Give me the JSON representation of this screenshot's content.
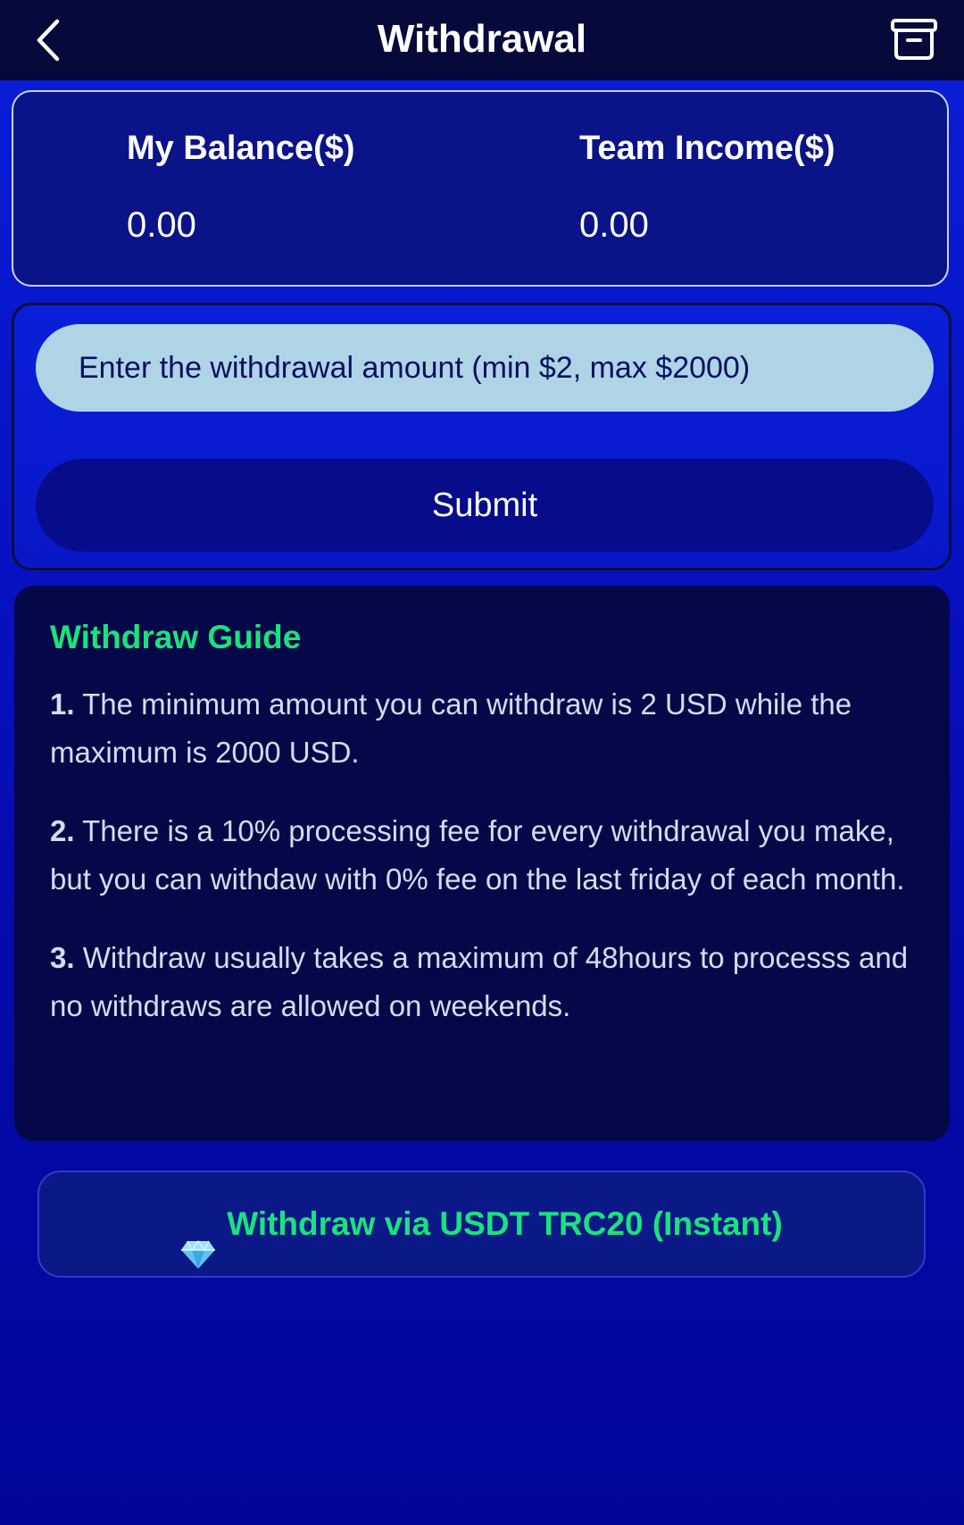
{
  "header": {
    "title": "Withdrawal",
    "back_icon": "chevron-left-icon",
    "right_icon": "archive-box-icon"
  },
  "balance": {
    "my_balance_label": "My Balance($)",
    "my_balance_value": "0.00",
    "team_income_label": "Team Income($)",
    "team_income_value": "0.00"
  },
  "form": {
    "amount_placeholder": "Enter the withdrawal amount (min $2, max $2000)",
    "amount_value": "",
    "submit_label": "Submit"
  },
  "guide": {
    "title": "Withdraw Guide",
    "items": [
      {
        "num": "1.",
        "text": " The minimum amount you can withdraw is 2 USD while the maximum is 2000 USD."
      },
      {
        "num": "2.",
        "text": " There is a 10% processing fee for every withdrawal you make, but you can withdaw with 0% fee on the last friday of each month."
      },
      {
        "num": "3.",
        "text": " Withdraw usually takes a maximum of 48hours to processs and no withdraws are allowed on weekends."
      }
    ]
  },
  "usdt_button": {
    "icon": "diamond-gem-icon",
    "label": "Withdraw via USDT TRC20 (Instant)"
  },
  "colors": {
    "header_bg": "#050a3a",
    "accent_green": "#19e37d",
    "input_bg": "#aed4e6",
    "guide_bg": "#050848"
  }
}
